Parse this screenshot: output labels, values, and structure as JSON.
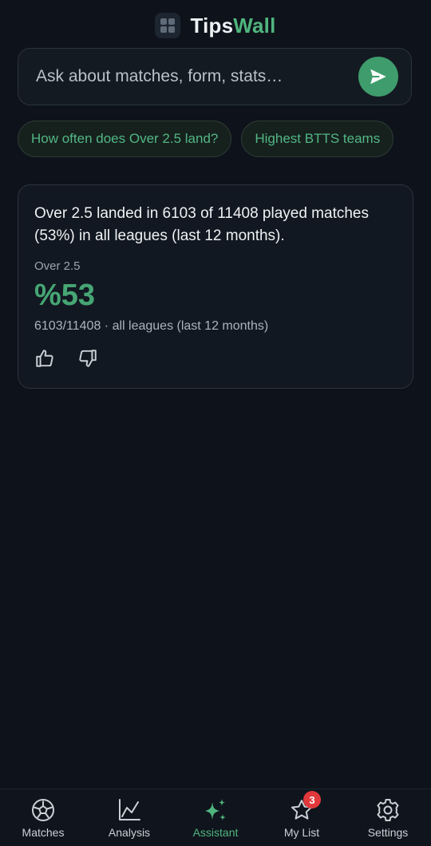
{
  "header": {
    "brand_part1": "Tips",
    "brand_part2": "Wall",
    "logo_icon": "grid-logo-icon"
  },
  "search": {
    "placeholder": "Ask about matches, form, stats…",
    "value": "",
    "send_icon": "send-icon"
  },
  "suggestions": [
    {
      "label": "How often does Over 2.5 land?"
    },
    {
      "label": "Highest BTTS teams"
    }
  ],
  "result": {
    "answer": "Over 2.5 landed in 6103 of 11408 played matches (53%) in all leagues (last 12 months).",
    "metric_label": "Over 2.5",
    "metric_value": "%53",
    "metric_sub": "6103/11408 · all leagues (last 12 months)",
    "feedback_icons": [
      "thumbs-up-icon",
      "thumbs-down-icon"
    ]
  },
  "nav": {
    "items": [
      {
        "label": "Matches",
        "icon": "soccer-ball-icon",
        "active": false
      },
      {
        "label": "Analysis",
        "icon": "line-chart-icon",
        "active": false
      },
      {
        "label": "Assistant",
        "icon": "sparkles-icon",
        "active": true
      },
      {
        "label": "My List",
        "icon": "star-icon",
        "active": false,
        "badge": "3"
      },
      {
        "label": "Settings",
        "icon": "gear-icon",
        "active": false
      }
    ]
  },
  "colors": {
    "background": "#0e121a",
    "accent": "#4fb57e",
    "badge": "#e0383b"
  }
}
